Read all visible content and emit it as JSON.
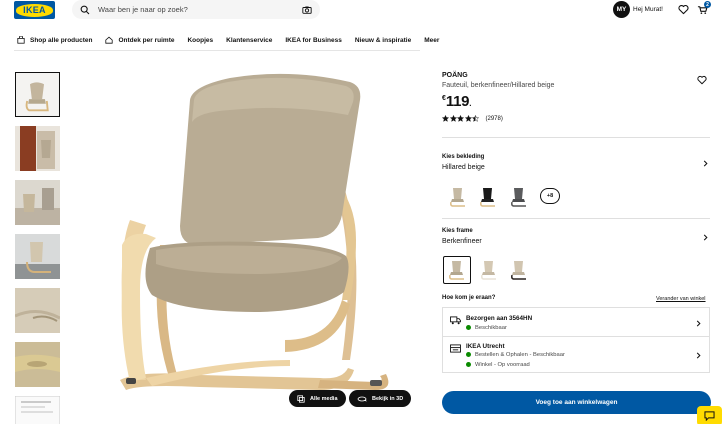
{
  "header": {
    "logo": "IKEA",
    "search_placeholder": "Waar ben je naar op zoek?",
    "avatar_initials": "MY",
    "greeting": "Hej Murat!",
    "cart_count": "2"
  },
  "nav": {
    "items": [
      "Shop alle producten",
      "Ontdek per ruimte",
      "Koopjes",
      "Klantenservice",
      "IKEA for Business",
      "Nieuw & inspiratie",
      "Meer"
    ]
  },
  "media": {
    "all_media": "Alle media",
    "view_3d": "Bekijk in 3D"
  },
  "product": {
    "name": "POÄNG",
    "description": "Fauteuil, berkenfineer/Hillared beige",
    "currency": "€",
    "price": "119",
    "price_suffix": ".",
    "rating": 4.5,
    "review_count": "(2978)"
  },
  "cover": {
    "label": "Kies bekleding",
    "value": "Hillared beige",
    "more": "+8"
  },
  "frame": {
    "label": "Kies frame",
    "value": "Berkenfineer"
  },
  "delivery": {
    "question": "Hoe kom je eraan?",
    "change_link": "Verander van winkel",
    "ship_title": "Bezorgen aan 3564HN",
    "ship_status": "Beschikbaar",
    "store_title": "IKEA Utrecht",
    "store_line1": "Bestellen & Ophalen - Beschikbaar",
    "store_line2": "Winkel - Op voorraad"
  },
  "cta": {
    "add_to_cart": "Voeg toe aan winkelwagen"
  },
  "colors": {
    "ikea_blue": "#0058a3",
    "ikea_yellow": "#ffdb00",
    "available_green": "#0a8a00"
  }
}
